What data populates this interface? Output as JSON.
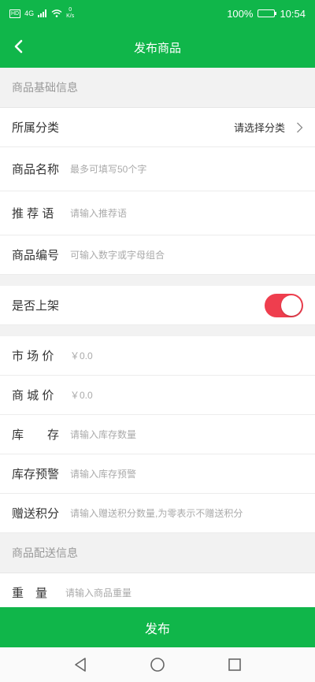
{
  "status": {
    "signal_text": "0",
    "speed_unit": "K/s",
    "hd": "HD",
    "lte": "4G",
    "battery": "100%",
    "time": "10:54"
  },
  "header": {
    "title": "发布商品"
  },
  "sections": {
    "basic": "商品基础信息",
    "delivery": "商品配送信息"
  },
  "fields": {
    "category": {
      "label": "所属分类",
      "value": "请选择分类"
    },
    "name": {
      "label": "商品名称",
      "placeholder": "最多可填写50个字"
    },
    "slogan": {
      "label": "推 荐 语",
      "placeholder": "请输入推荐语"
    },
    "code": {
      "label": "商品编号",
      "placeholder": "可输入数字或字母组合"
    },
    "on_shelf": {
      "label": "是否上架",
      "value": true
    },
    "market_price": {
      "label": "市 场 价",
      "placeholder": "￥0.0"
    },
    "mall_price": {
      "label": "商 城 价",
      "placeholder": "￥0.0"
    },
    "stock": {
      "label": "库　　存",
      "placeholder": "请输入库存数量"
    },
    "stock_warning": {
      "label": "库存预警",
      "placeholder": "请输入库存预警"
    },
    "points": {
      "label": "赠送积分",
      "placeholder": "请输入赠送积分数量,为零表示不赠送积分"
    },
    "weight": {
      "label": "重　量",
      "placeholder": "请输入商品重量"
    }
  },
  "publish_label": "发布",
  "colors": {
    "primary": "#10b64a",
    "toggle_on": "#ef3e4e"
  }
}
